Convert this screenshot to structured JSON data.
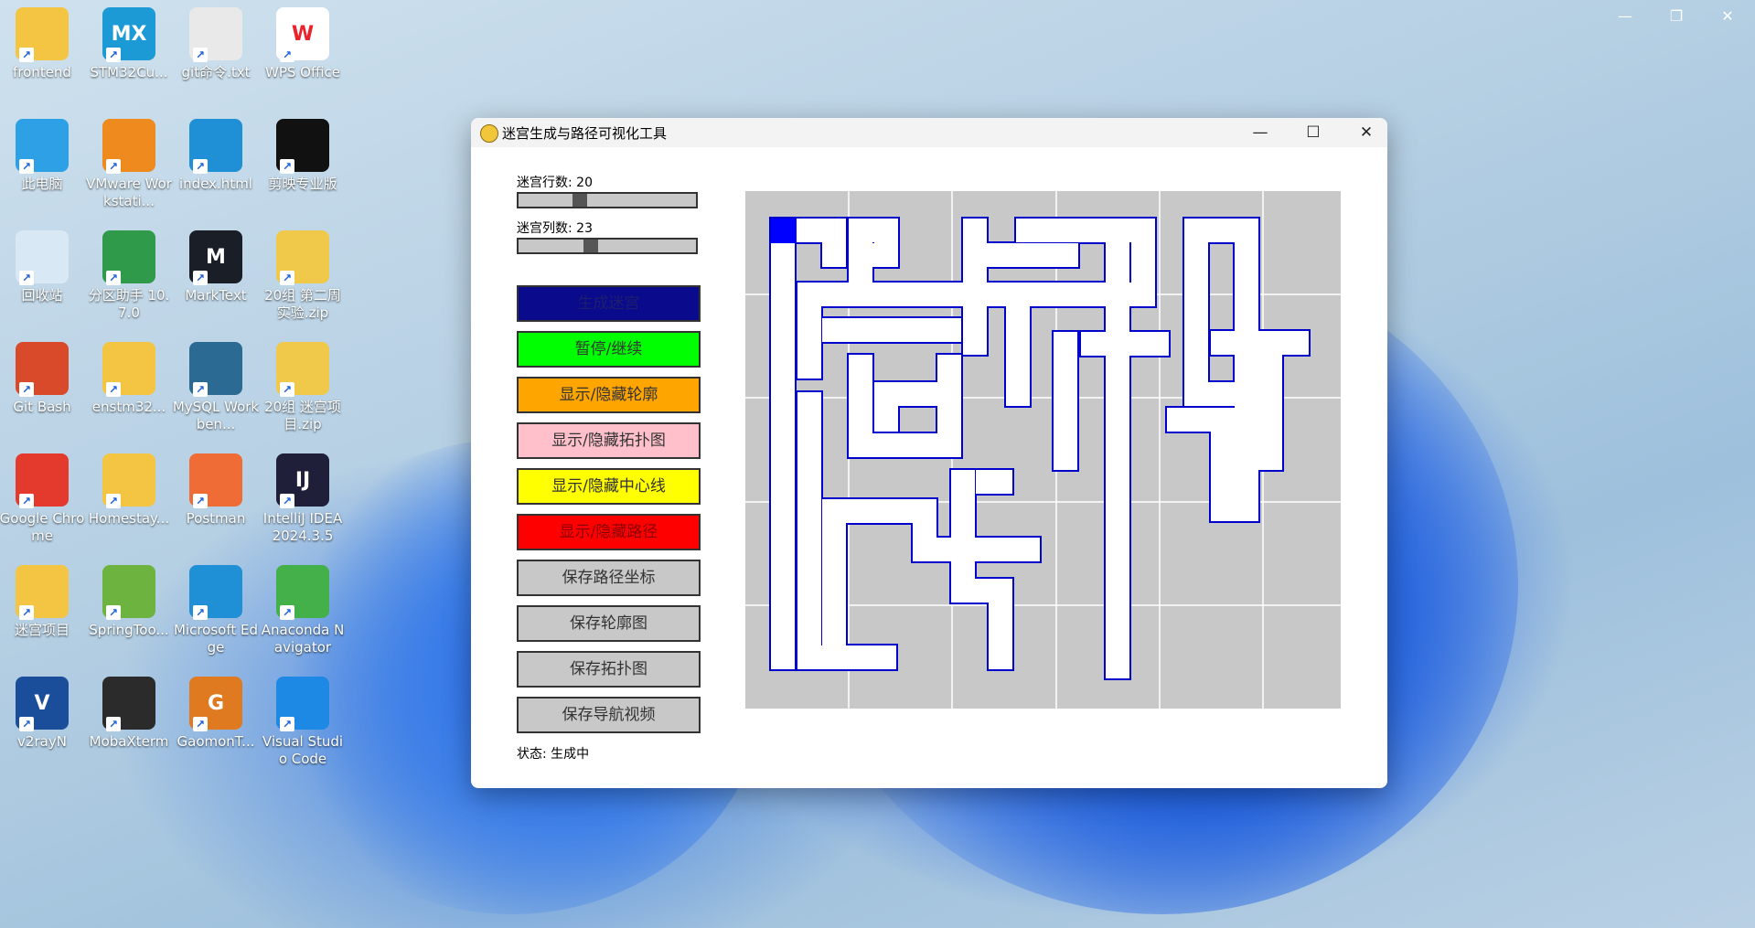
{
  "desktop": {
    "icons": [
      {
        "label": "frontend",
        "icon": "folder-icon"
      },
      {
        "label": "STM32Cu...",
        "icon": "stm32cubemx-icon",
        "badge": "MX"
      },
      {
        "label": "git命令.txt",
        "icon": "text-file-icon"
      },
      {
        "label": "WPS Office",
        "icon": "wps-office-icon",
        "badge": "W"
      },
      {
        "label": "此电脑",
        "icon": "computer-icon"
      },
      {
        "label": "VMware Workstati...",
        "icon": "vmware-icon"
      },
      {
        "label": "index.html",
        "icon": "edge-file-icon"
      },
      {
        "label": "剪映专业版",
        "icon": "capcut-icon"
      },
      {
        "label": "回收站",
        "icon": "recycle-bin-icon"
      },
      {
        "label": "分区助手 10.7.0",
        "icon": "partition-assistant-icon"
      },
      {
        "label": "MarkText",
        "icon": "marktext-icon",
        "badge": "M"
      },
      {
        "label": "20组 第二周实验.zip",
        "icon": "zip-folder-icon"
      },
      {
        "label": "Git Bash",
        "icon": "git-bash-icon"
      },
      {
        "label": "enstm32...",
        "icon": "folder-icon"
      },
      {
        "label": "MySQL Workben...",
        "icon": "mysql-workbench-icon"
      },
      {
        "label": "20组 迷宫项目.zip",
        "icon": "zip-folder-icon"
      },
      {
        "label": "Google Chrome",
        "icon": "chrome-icon"
      },
      {
        "label": "Homestay...",
        "icon": "folder-icon"
      },
      {
        "label": "Postman",
        "icon": "postman-icon"
      },
      {
        "label": "IntelliJ IDEA 2024.3.5",
        "icon": "intellij-icon",
        "badge": "IJ"
      },
      {
        "label": "迷宫项目",
        "icon": "folder-icon"
      },
      {
        "label": "SpringToo...",
        "icon": "spring-tools-icon"
      },
      {
        "label": "Microsoft Edge",
        "icon": "edge-icon"
      },
      {
        "label": "Anaconda Navigator",
        "icon": "anaconda-icon"
      },
      {
        "label": "v2rayN",
        "icon": "v2rayn-icon",
        "badge": "V"
      },
      {
        "label": "MobaXterm",
        "icon": "mobaxterm-icon"
      },
      {
        "label": "GaomonT...",
        "icon": "gaomon-icon",
        "badge": "G"
      },
      {
        "label": "Visual Studio Code",
        "icon": "vscode-icon"
      }
    ],
    "top_controls": {
      "minimize": "—",
      "restore": "❐",
      "close": "✕"
    }
  },
  "window": {
    "title": "迷宫生成与路径可视化工具",
    "controls": {
      "minimize": "—",
      "maximize": "☐",
      "close": "✕"
    }
  },
  "controls": {
    "rows_label": "迷宫行数: 20",
    "rows_value": 20,
    "rows_range": [
      5,
      50
    ],
    "cols_label": "迷宫列数: 23",
    "cols_value": 23,
    "cols_range": [
      5,
      50
    ],
    "buttons": [
      {
        "id": "generate",
        "label": "生成迷宫",
        "color": "#0a0a8c",
        "text_color": "#1e1e6e"
      },
      {
        "id": "pause",
        "label": "暂停/继续",
        "color": "#00ff00",
        "text_color": "#333333"
      },
      {
        "id": "outline",
        "label": "显示/隐藏轮廓",
        "color": "#ffa500",
        "text_color": "#333333"
      },
      {
        "id": "topology",
        "label": "显示/隐藏拓扑图",
        "color": "#ffc0cb",
        "text_color": "#333333"
      },
      {
        "id": "centerline",
        "label": "显示/隐藏中心线",
        "color": "#ffff00",
        "text_color": "#333333"
      },
      {
        "id": "path",
        "label": "显示/隐藏路径",
        "color": "#ff0000",
        "text_color": "#8a0000"
      },
      {
        "id": "save_path",
        "label": "保存路径坐标",
        "color": "#c8c8c8",
        "text_color": "#333333"
      },
      {
        "id": "save_outline",
        "label": "保存轮廓图",
        "color": "#c8c8c8",
        "text_color": "#333333"
      },
      {
        "id": "save_topology",
        "label": "保存拓扑图",
        "color": "#c8c8c8",
        "text_color": "#333333"
      },
      {
        "id": "save_video",
        "label": "保存导航视频",
        "color": "#c8c8c8",
        "text_color": "#333333"
      }
    ],
    "status": "状态: 生成中"
  },
  "maze": {
    "wall_color": "#0000cc",
    "cell_fill": "#ffffff",
    "background": "#c8c8c8",
    "grid_color": "#ffffff",
    "current_cell_color": "#0000ff",
    "rows": 20,
    "cols": 23
  }
}
